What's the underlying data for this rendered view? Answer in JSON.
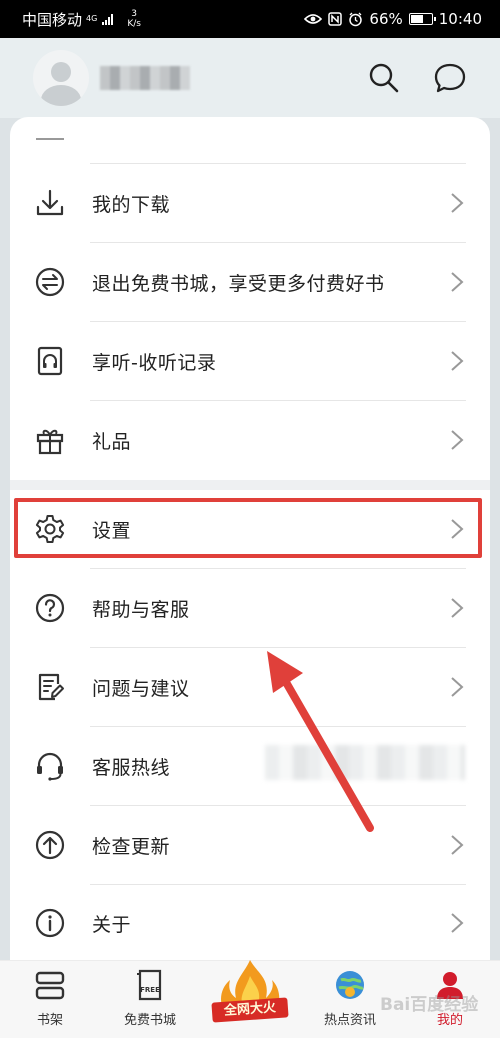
{
  "status_bar": {
    "carrier": "中国移动",
    "network": "4G",
    "speed_value": "3",
    "speed_unit": "K/s",
    "battery_percent": "66%",
    "battery_level": 0.66,
    "time": "10:40"
  },
  "header": {
    "username": "",
    "icons": [
      "search-icon",
      "message-icon"
    ]
  },
  "menu_items": [
    {
      "label": "我的下载",
      "icon": "download-icon"
    },
    {
      "label": "退出免费书城，享受更多付费好书",
      "icon": "switch-icon"
    },
    {
      "label": "享听-收听记录",
      "icon": "audiobook-icon"
    },
    {
      "label": "礼品",
      "icon": "gift-icon"
    },
    {
      "label": "设置",
      "icon": "gear-icon"
    },
    {
      "label": "帮助与客服",
      "icon": "help-icon"
    },
    {
      "label": "问题与建议",
      "icon": "feedback-icon"
    },
    {
      "label": "客服热线",
      "icon": "headset-icon"
    },
    {
      "label": "检查更新",
      "icon": "update-icon"
    },
    {
      "label": "关于",
      "icon": "info-icon"
    }
  ],
  "tabbar": {
    "tabs": [
      {
        "label": "书架",
        "icon": "bookshelf-icon"
      },
      {
        "label": "免费书城",
        "icon": "free-book-icon"
      },
      {
        "label": "全网大火",
        "icon": "flame-icon"
      },
      {
        "label": "热点资讯",
        "icon": "news-globe-icon"
      },
      {
        "label": "我的",
        "icon": "profile-icon"
      }
    ],
    "watermark": "Bai百度经验"
  },
  "colors": {
    "highlight": "#e0403a",
    "active_tab": "#d11c2c"
  }
}
